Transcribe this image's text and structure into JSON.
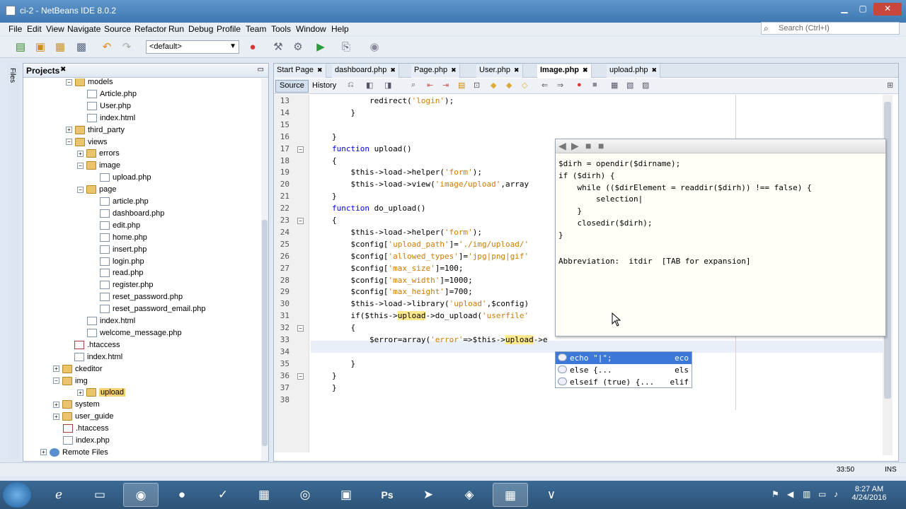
{
  "window": {
    "title": "ci-2 - NetBeans IDE 8.0.2"
  },
  "menu": [
    "File",
    "Edit",
    "View",
    "Navigate",
    "Source",
    "Refactor",
    "Run",
    "Debug",
    "Profile",
    "Team",
    "Tools",
    "Window",
    "Help"
  ],
  "search": {
    "placeholder": "Search (Ctrl+I)"
  },
  "toolbar": {
    "config_value": "<default>"
  },
  "left_strip": {
    "label": "Files"
  },
  "projects": {
    "title": "Projects",
    "tree": [
      {
        "label": "models",
        "type": "folder",
        "expander": "−"
      },
      {
        "label": "Article.php",
        "type": "file"
      },
      {
        "label": "User.php",
        "type": "file"
      },
      {
        "label": "index.html",
        "type": "file"
      },
      {
        "label": "third_party",
        "type": "folder",
        "expander": "+"
      },
      {
        "label": "views",
        "type": "folder",
        "expander": "−"
      },
      {
        "label": "errors",
        "type": "folder",
        "expander": "+"
      },
      {
        "label": "image",
        "type": "folder",
        "expander": "−"
      },
      {
        "label": "upload.php",
        "type": "file"
      },
      {
        "label": "page",
        "type": "folder",
        "expander": "−"
      },
      {
        "label": "article.php",
        "type": "file"
      },
      {
        "label": "dashboard.php",
        "type": "file"
      },
      {
        "label": "edit.php",
        "type": "file"
      },
      {
        "label": "home.php",
        "type": "file"
      },
      {
        "label": "insert.php",
        "type": "file"
      },
      {
        "label": "login.php",
        "type": "file"
      },
      {
        "label": "read.php",
        "type": "file"
      },
      {
        "label": "register.php",
        "type": "file"
      },
      {
        "label": "reset_password.php",
        "type": "file"
      },
      {
        "label": "reset_password_email.php",
        "type": "file"
      },
      {
        "label": "index.html",
        "type": "file"
      },
      {
        "label": "welcome_message.php",
        "type": "file"
      },
      {
        "label": ".htaccess",
        "type": "ht"
      },
      {
        "label": "index.html",
        "type": "file"
      },
      {
        "label": "ckeditor",
        "type": "folder",
        "expander": "+"
      },
      {
        "label": "img",
        "type": "folder",
        "expander": "−"
      },
      {
        "label": "upload",
        "type": "folder",
        "expander": "+",
        "selected": true
      },
      {
        "label": "system",
        "type": "folder",
        "expander": "+"
      },
      {
        "label": "user_guide",
        "type": "folder",
        "expander": "+"
      },
      {
        "label": ".htaccess",
        "type": "ht"
      },
      {
        "label": "index.php",
        "type": "file"
      },
      {
        "label": "Remote Files",
        "type": "globe",
        "expander": "+"
      }
    ]
  },
  "editor": {
    "tabs": [
      {
        "label": "Start Page",
        "active": false
      },
      {
        "label": "dashboard.php",
        "active": false
      },
      {
        "label": "Page.php",
        "active": false
      },
      {
        "label": "User.php",
        "active": false
      },
      {
        "label": "Image.php",
        "active": true
      },
      {
        "label": "upload.php",
        "active": false
      }
    ],
    "source_label": "Source",
    "history_label": "History",
    "line_numbers": [
      "13",
      "14",
      "15",
      "16",
      "17",
      "18",
      "19",
      "20",
      "21",
      "22",
      "23",
      "24",
      "25",
      "26",
      "27",
      "28",
      "29",
      "30",
      "31",
      "32",
      "33",
      "34",
      "35",
      "36",
      "37",
      "38"
    ],
    "lines": [
      "        redirect('login');",
      "    }",
      "",
      "}",
      "function upload()",
      "{",
      "    $this->load->helper('form');",
      "    $this->load->view('image/upload',array",
      "}",
      "function do_upload()",
      "{",
      "    $this->load->helper('form');",
      "    $config['upload_path']='./img/upload/'",
      "    $config['allowed_types']='jpg|png|gif'",
      "    $config['max_size']=100;",
      "    $config['max_width']=1000;",
      "    $config['max_height']=700;",
      "    $this->load->library('upload',$config)",
      "    if($this->upload->do_upload('userfile'",
      "    {",
      "        $error=array('error'=>$this->upload->e",
      "",
      "    }",
      "}",
      "}",
      ""
    ]
  },
  "doc_popup": {
    "lines": [
      "$dirh = opendir($dirname);",
      "if ($dirh) {",
      "    while (($dirElement = readdir($dirh)) !== false) {",
      "        selection|",
      "    }",
      "    closedir($dirh);",
      "}"
    ],
    "abbreviation": "Abbreviation:  itdir  [TAB for expansion]"
  },
  "completion": [
    {
      "text": "echo \"|\";",
      "shortcut": "eco",
      "selected": true
    },
    {
      "text": "else {...",
      "shortcut": "els",
      "selected": false
    },
    {
      "text": "elseif (true) {...",
      "shortcut": "elif",
      "selected": false
    }
  ],
  "status": {
    "position": "33:50",
    "mode": "INS"
  },
  "taskbar": {
    "time": "8:27 AM",
    "date": "4/24/2016"
  },
  "colors": {
    "keyword": "#0000e6",
    "string": "#ce7b00",
    "highlight": "#ffe98c",
    "selection": "#3b78d8"
  }
}
